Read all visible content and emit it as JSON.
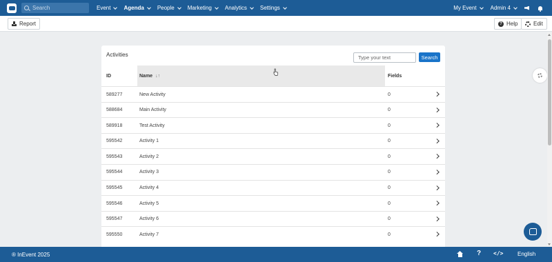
{
  "nav": {
    "search_placeholder": "Search",
    "items": [
      {
        "label": "Event",
        "bold": false
      },
      {
        "label": "Agenda",
        "bold": true
      },
      {
        "label": "People",
        "bold": false
      },
      {
        "label": "Marketing",
        "bold": false
      },
      {
        "label": "Analytics",
        "bold": false
      },
      {
        "label": "Settings",
        "bold": false
      }
    ],
    "my_event": "My Event",
    "admin": "Admin 4"
  },
  "toolbar": {
    "report_label": "Report",
    "help_label": "Help",
    "edit_label": "Edit"
  },
  "card": {
    "title": "Activities",
    "search_placeholder": "Type your text",
    "search_button": "Search",
    "columns": {
      "id": "ID",
      "name": "Name",
      "fields": "Fields"
    },
    "rows": [
      {
        "id": "589277",
        "name": "New Activity",
        "fields": "0"
      },
      {
        "id": "588684",
        "name": "Main Activity",
        "fields": "0"
      },
      {
        "id": "589918",
        "name": "Test Activity",
        "fields": "0"
      },
      {
        "id": "595542",
        "name": "Activity 1",
        "fields": "0"
      },
      {
        "id": "595543",
        "name": "Activity 2",
        "fields": "0"
      },
      {
        "id": "595544",
        "name": "Activity 3",
        "fields": "0"
      },
      {
        "id": "595545",
        "name": "Activity 4",
        "fields": "0"
      },
      {
        "id": "595546",
        "name": "Activity 5",
        "fields": "0"
      },
      {
        "id": "595547",
        "name": "Activity 6",
        "fields": "0"
      },
      {
        "id": "595550",
        "name": "Activity 7",
        "fields": "0"
      }
    ]
  },
  "footer": {
    "copyright": "® InEvent 2025",
    "language": "English"
  },
  "colors": {
    "brand": "#1d5c96",
    "accent": "#1a74c9"
  }
}
